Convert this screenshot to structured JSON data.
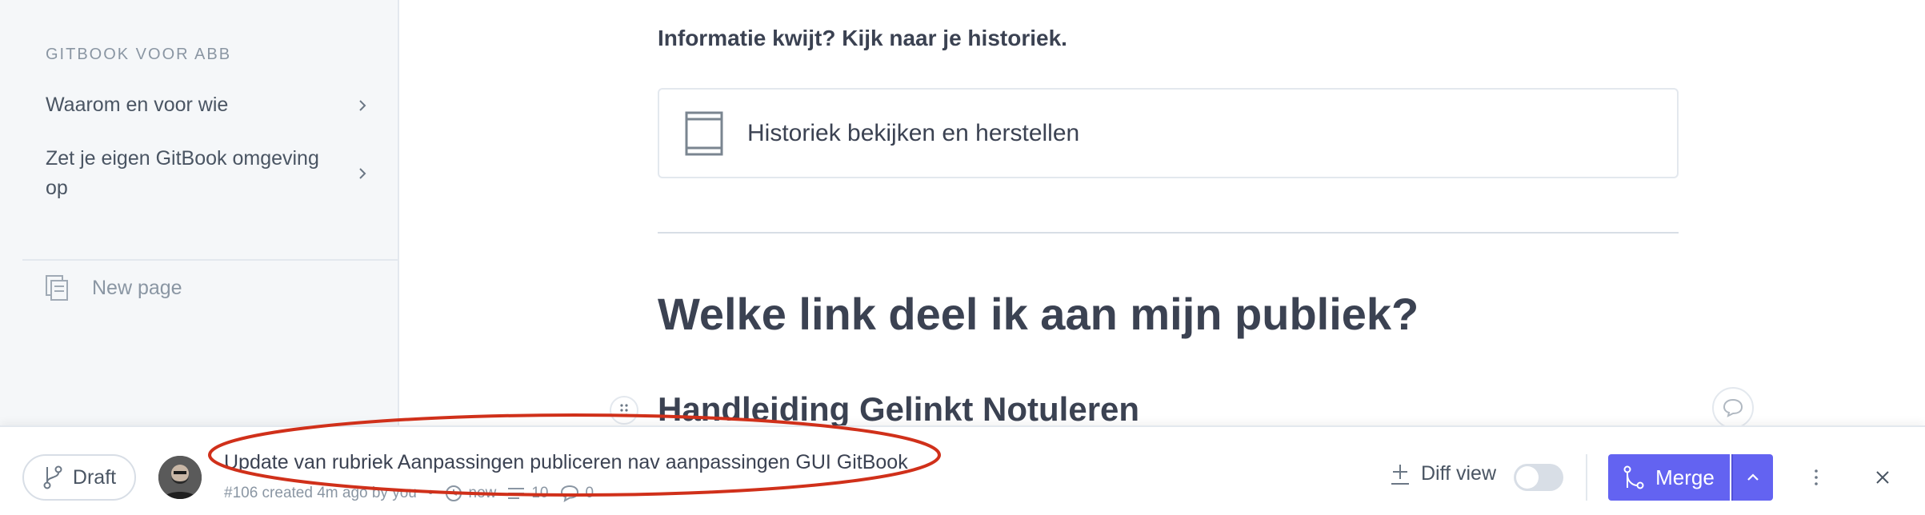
{
  "sidebar": {
    "heading": "GITBOOK VOOR ABB",
    "items": [
      {
        "label": "Waarom en voor wie",
        "icon": "chevron-right-icon"
      },
      {
        "label": "Zet je eigen GitBook omgeving op",
        "icon": "chevron-right-icon"
      }
    ],
    "new_page_label": "New page"
  },
  "main": {
    "subheading": "Informatie kwijt? Kijk naar je historiek.",
    "card_label": "Historiek bekijken en herstellen",
    "heading": "Welke link deel ik aan mijn publiek?",
    "subsection": "Handleiding Gelinkt Notuleren"
  },
  "change_request": {
    "status_label": "Draft",
    "title": "Update van rubriek Aanpassingen publiceren nav aanpassingen GUI GitBook",
    "meta": {
      "info": "#106 created 4m ago by you",
      "updated": "now",
      "edits": "10",
      "comments": "0"
    },
    "diff_view_label": "Diff view",
    "diff_view_enabled": false,
    "merge_label": "Merge"
  },
  "colors": {
    "accent": "#6363f1",
    "highlight_annotation": "#d0301a",
    "sidebar_bg": "#f5f7f9"
  }
}
